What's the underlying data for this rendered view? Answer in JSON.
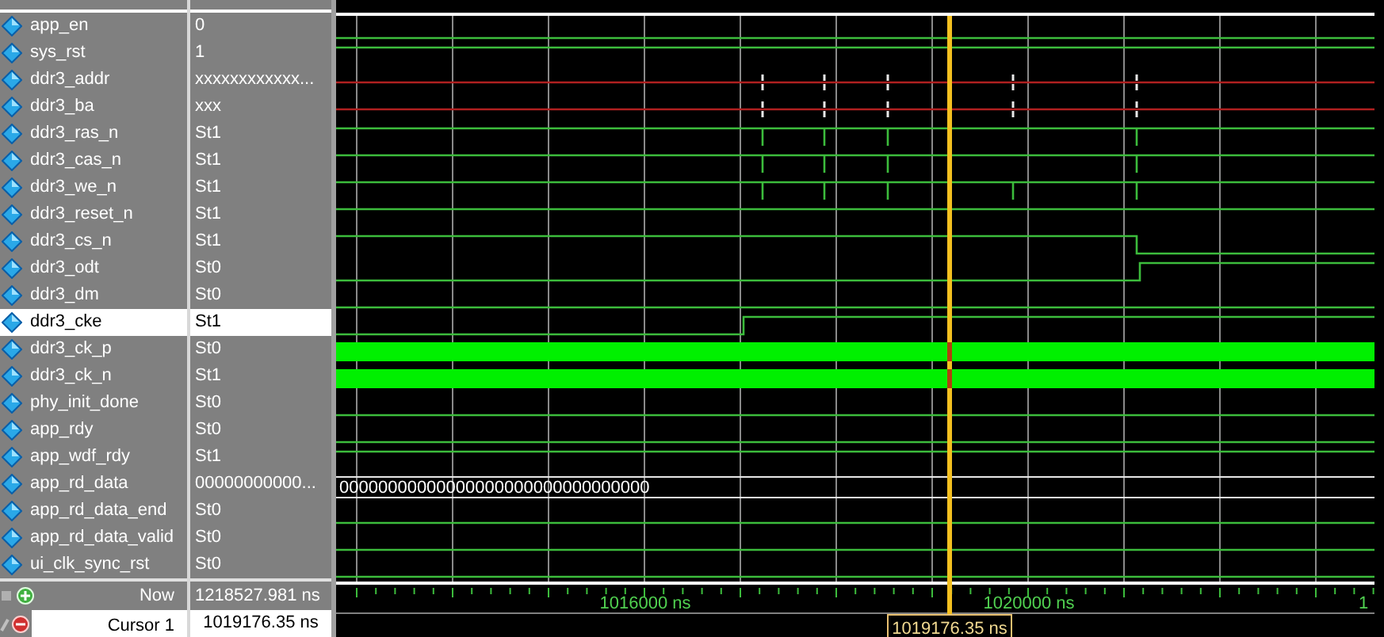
{
  "signals": [
    {
      "name": "app_en",
      "value": "0",
      "kind": "bit",
      "selected": false
    },
    {
      "name": "sys_rst",
      "value": "1",
      "kind": "bit",
      "selected": false
    },
    {
      "name": "ddr3_addr",
      "value": "xxxxxxxxxxxx...",
      "kind": "unknown",
      "selected": false
    },
    {
      "name": "ddr3_ba",
      "value": "xxx",
      "kind": "unknown",
      "selected": false
    },
    {
      "name": "ddr3_ras_n",
      "value": "St1",
      "kind": "bit",
      "selected": false
    },
    {
      "name": "ddr3_cas_n",
      "value": "St1",
      "kind": "bit",
      "selected": false
    },
    {
      "name": "ddr3_we_n",
      "value": "St1",
      "kind": "bit",
      "selected": false
    },
    {
      "name": "ddr3_reset_n",
      "value": "St1",
      "kind": "bit",
      "selected": false
    },
    {
      "name": "ddr3_cs_n",
      "value": "St1",
      "kind": "bit",
      "selected": false
    },
    {
      "name": "ddr3_odt",
      "value": "St0",
      "kind": "bit",
      "selected": false
    },
    {
      "name": "ddr3_dm",
      "value": "St0",
      "kind": "bit",
      "selected": false
    },
    {
      "name": "ddr3_cke",
      "value": "St1",
      "kind": "bit",
      "selected": true
    },
    {
      "name": "ddr3_ck_p",
      "value": "St0",
      "kind": "clock",
      "selected": false
    },
    {
      "name": "ddr3_ck_n",
      "value": "St1",
      "kind": "clock",
      "selected": false
    },
    {
      "name": "phy_init_done",
      "value": "St0",
      "kind": "bit",
      "selected": false
    },
    {
      "name": "app_rdy",
      "value": "St0",
      "kind": "bit",
      "selected": false
    },
    {
      "name": "app_wdf_rdy",
      "value": "St1",
      "kind": "bit",
      "selected": false
    },
    {
      "name": "app_rd_data",
      "value": "00000000000...",
      "kind": "bus",
      "wave_text": "00000000000000000000000000000000",
      "selected": false
    },
    {
      "name": "app_rd_data_end",
      "value": "St0",
      "kind": "bit",
      "selected": false
    },
    {
      "name": "app_rd_data_valid",
      "value": "St0",
      "kind": "bit",
      "selected": false
    },
    {
      "name": "ui_clk_sync_rst",
      "value": "St0",
      "kind": "bit",
      "selected": false
    }
  ],
  "now": {
    "label": "Now",
    "value": "1218527.981 ns"
  },
  "cursor": {
    "label": "Cursor 1",
    "value": "1019176.35 ns",
    "marker": "1019176.35 ns"
  },
  "time_axis": {
    "labels": [
      "1016000 ns",
      "1020000 ns",
      "1"
    ]
  }
}
